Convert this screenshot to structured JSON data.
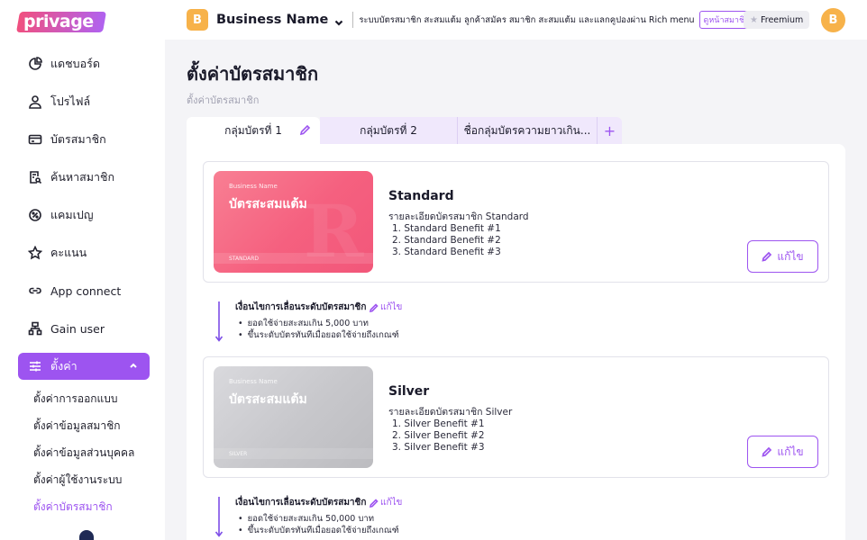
{
  "app": {
    "logo_text": "privage"
  },
  "sidebar": {
    "items": [
      {
        "label": "แดชบอร์ด",
        "icon": "pie-chart-icon"
      },
      {
        "label": "โปรไฟล์",
        "icon": "user-icon"
      },
      {
        "label": "บัตรสมาชิก",
        "icon": "card-icon"
      },
      {
        "label": "ค้นหาสมาชิก",
        "icon": "search-doc-icon"
      },
      {
        "label": "แคมเปญ",
        "icon": "badge-icon"
      },
      {
        "label": "คะแนน",
        "icon": "star-icon"
      },
      {
        "label": "App connect",
        "icon": "link-icon"
      },
      {
        "label": "Gain user",
        "icon": "org-chart-icon"
      }
    ],
    "active": {
      "label": "ตั้งค่า",
      "icon": "sliders-icon"
    },
    "sub_items": [
      "ตั้งค่าการออกแบบ",
      "ตั้งค่าข้อมูลสมาชิก",
      "ตั้งค่าข้อมูลส่วนบุคคล",
      "ตั้งค่าผู้ใช้งานระบบ",
      "ตั้งค่าบัตรสมาชิก"
    ]
  },
  "topbar": {
    "business_initial": "B",
    "business_name": "Business Name",
    "description": "ระบบบัตรสมาชิก สะสมแต้ม ลูกค้าสมัคร สมาชิก สะสมแต้ม และแลกคูปองผ่าน Rich menu",
    "link_label": "ดูหน้าสมาชิก",
    "plan_label": "Freemium",
    "user_initial": "B"
  },
  "page": {
    "title": "ตั้งค่าบัตรสมาชิก",
    "breadcrumb": "ตั้งค่าบัตรสมาชิก"
  },
  "tabs": [
    "กลุ่มบัตรที่ 1",
    "กลุ่มบัตรที่ 2",
    "ชื่อกลุ่มบัตรความยาวเกิน...",
    "+"
  ],
  "tiers": [
    {
      "card_business": "Business Name",
      "card_title": "บัตรสะสมแต้ม",
      "card_tier_label": "STANDARD",
      "name": "Standard",
      "desc_title": "รายละเอียดบัตรสมาชิก Standard",
      "benefits": [
        "1. Standard Benefit #1",
        "2. Standard Benefit #2",
        "3. Standard Benefit #3"
      ],
      "edit_label": "แก้ไข",
      "color": "#f5607f"
    },
    {
      "card_business": "Business Name",
      "card_title": "บัตรสะสมแต้ม",
      "card_tier_label": "SILVER",
      "name": "Silver",
      "desc_title": "รายละเอียดบัตรสมาชิก Silver",
      "benefits": [
        "1. Silver Benefit #1",
        "2. Silver Benefit #2",
        "3. Silver Benefit #3"
      ],
      "edit_label": "แก้ไข",
      "color": "#c7c7cb"
    }
  ],
  "conditions": [
    {
      "title": "เงื่อนไขการเลื่อนระดับบัตรสมาชิก",
      "edit_label": "แก้ไข",
      "lines": [
        "ยอดใช้จ่ายสะสมเกิน 5,000 บาท",
        "ขึ้นระดับบัตรทันทีเมื่อยอดใช้จ่ายถึงเกณฑ์"
      ]
    },
    {
      "title": "เงื่อนไขการเลื่อนระดับบัตรสมาชิก",
      "edit_label": "แก้ไข",
      "lines": [
        "ยอดใช้จ่ายสะสมเกิน 50,000 บาท",
        "ขึ้นระดับบัตรทันทีเมื่อยอดใช้จ่ายถึงเกณฑ์"
      ]
    }
  ],
  "colors": {
    "accent": "#9d54f0",
    "brand_avatar": "#f7b24a"
  }
}
